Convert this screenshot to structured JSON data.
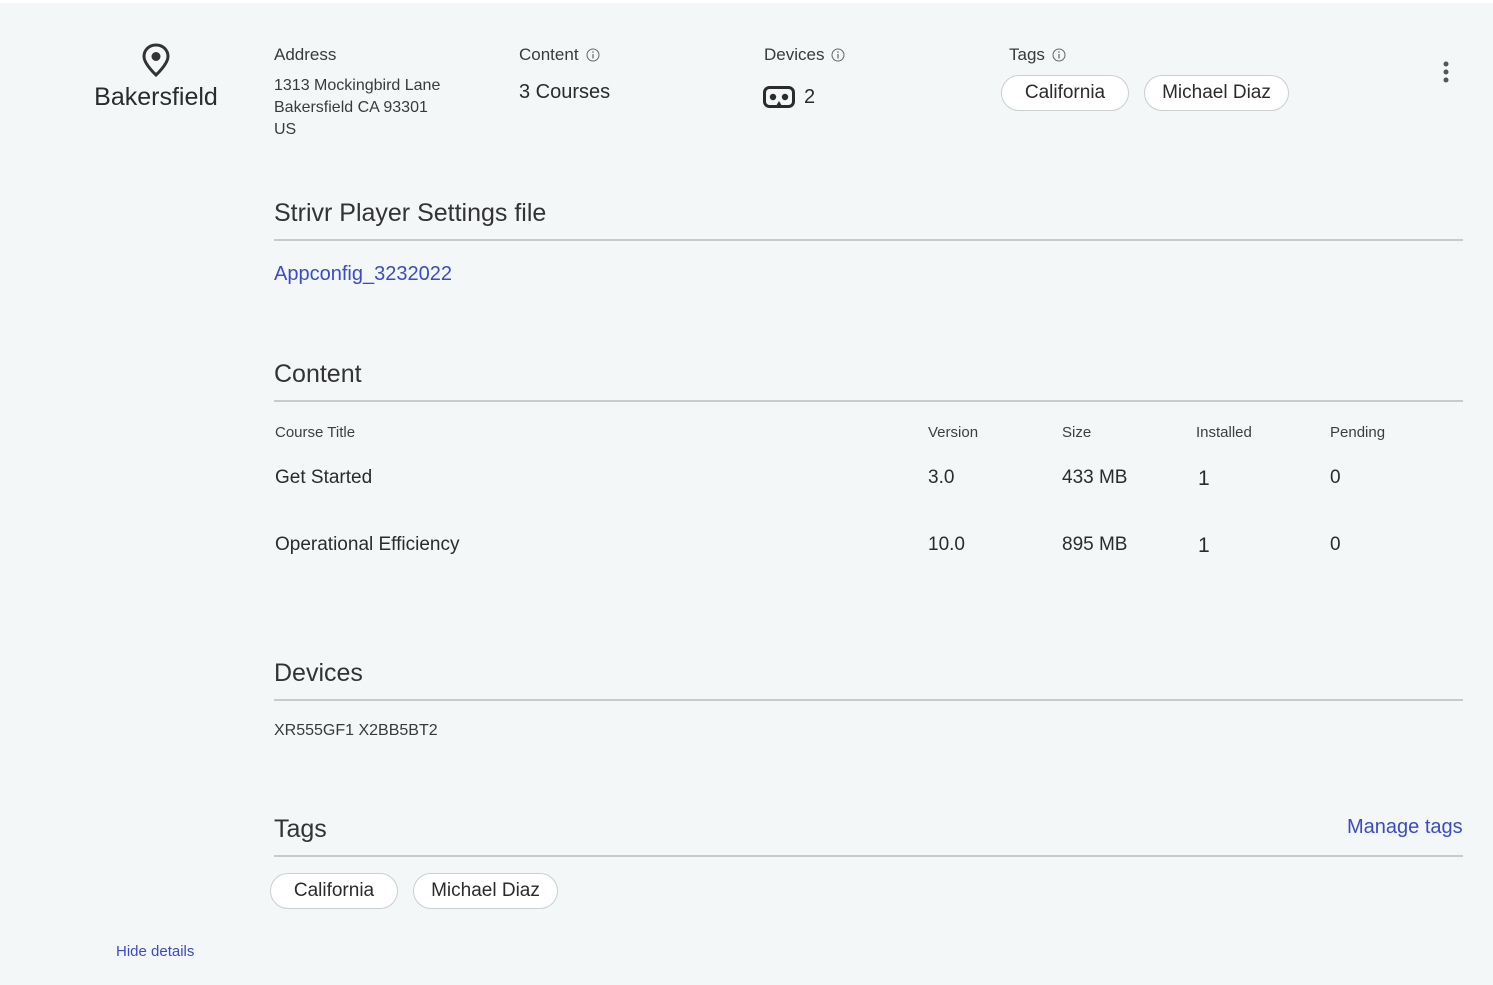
{
  "location": {
    "name": "Bakersfield",
    "icon": "location-pin-icon"
  },
  "summary": {
    "address": {
      "label": "Address",
      "line1": "1313 Mockingbird Lane",
      "line2": "Bakersfield CA 93301",
      "line3": "US"
    },
    "content": {
      "label": "Content",
      "value": "3 Courses"
    },
    "devices": {
      "label": "Devices",
      "value": "2",
      "icon": "vr-headset-icon"
    },
    "tags": {
      "label": "Tags",
      "items": [
        "California",
        "Michael Diaz"
      ]
    }
  },
  "settings_file": {
    "title": "Strivr Player Settings file",
    "link": "Appconfig_3232022"
  },
  "content_section": {
    "title": "Content",
    "columns": [
      "Course Title",
      "Version",
      "Size",
      "Installed",
      "Pending"
    ],
    "rows": [
      [
        "Get Started",
        "3.0",
        "433 MB",
        "1",
        "0"
      ],
      [
        "Operational Efficiency",
        "10.0",
        "895 MB",
        "1",
        "0"
      ]
    ]
  },
  "devices_section": {
    "title": "Devices",
    "list": "XR555GF1 X2BB5BT2"
  },
  "tags_section": {
    "title": "Tags",
    "manage_label": "Manage tags",
    "items": [
      "California",
      "Michael Diaz"
    ]
  },
  "footer": {
    "hide_details": "Hide details"
  },
  "colors": {
    "link": "#3b4bc6",
    "panel_bg": "#f3f7f8",
    "rule": "#c7cbcd"
  }
}
